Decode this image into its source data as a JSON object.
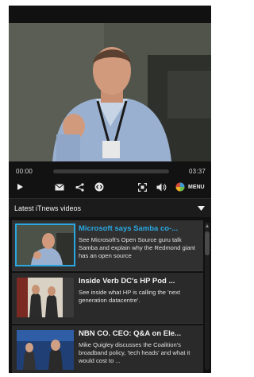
{
  "player": {
    "current_time": "00:00",
    "total_time": "03:37",
    "progress_fraction": 0.0,
    "menu_label": "MENU",
    "icons": [
      "play-icon",
      "mail-icon",
      "share-icon",
      "embed-icon",
      "fullscreen-icon",
      "volume-icon",
      "menu-icon"
    ]
  },
  "playlist": {
    "title": "Latest iTnews videos",
    "items": [
      {
        "title": "Microsoft says Samba co-...",
        "description": "See Microsoft's Open Source guru talk Samba and explain why the Redmond giant has an open source",
        "active": true
      },
      {
        "title": "Inside Verb DC's HP Pod ...",
        "description": "See inside what HP is calling the 'next generation datacentre'.",
        "active": false
      },
      {
        "title": "NBN CO. CEO: Q&A on Ele...",
        "description": "Mike Quigley discusses the Coalition's broadband policy, 'tech heads' and what it would cost to ...",
        "active": false
      }
    ]
  },
  "colors": {
    "accent": "#2aa7e0",
    "background": "#111111"
  }
}
